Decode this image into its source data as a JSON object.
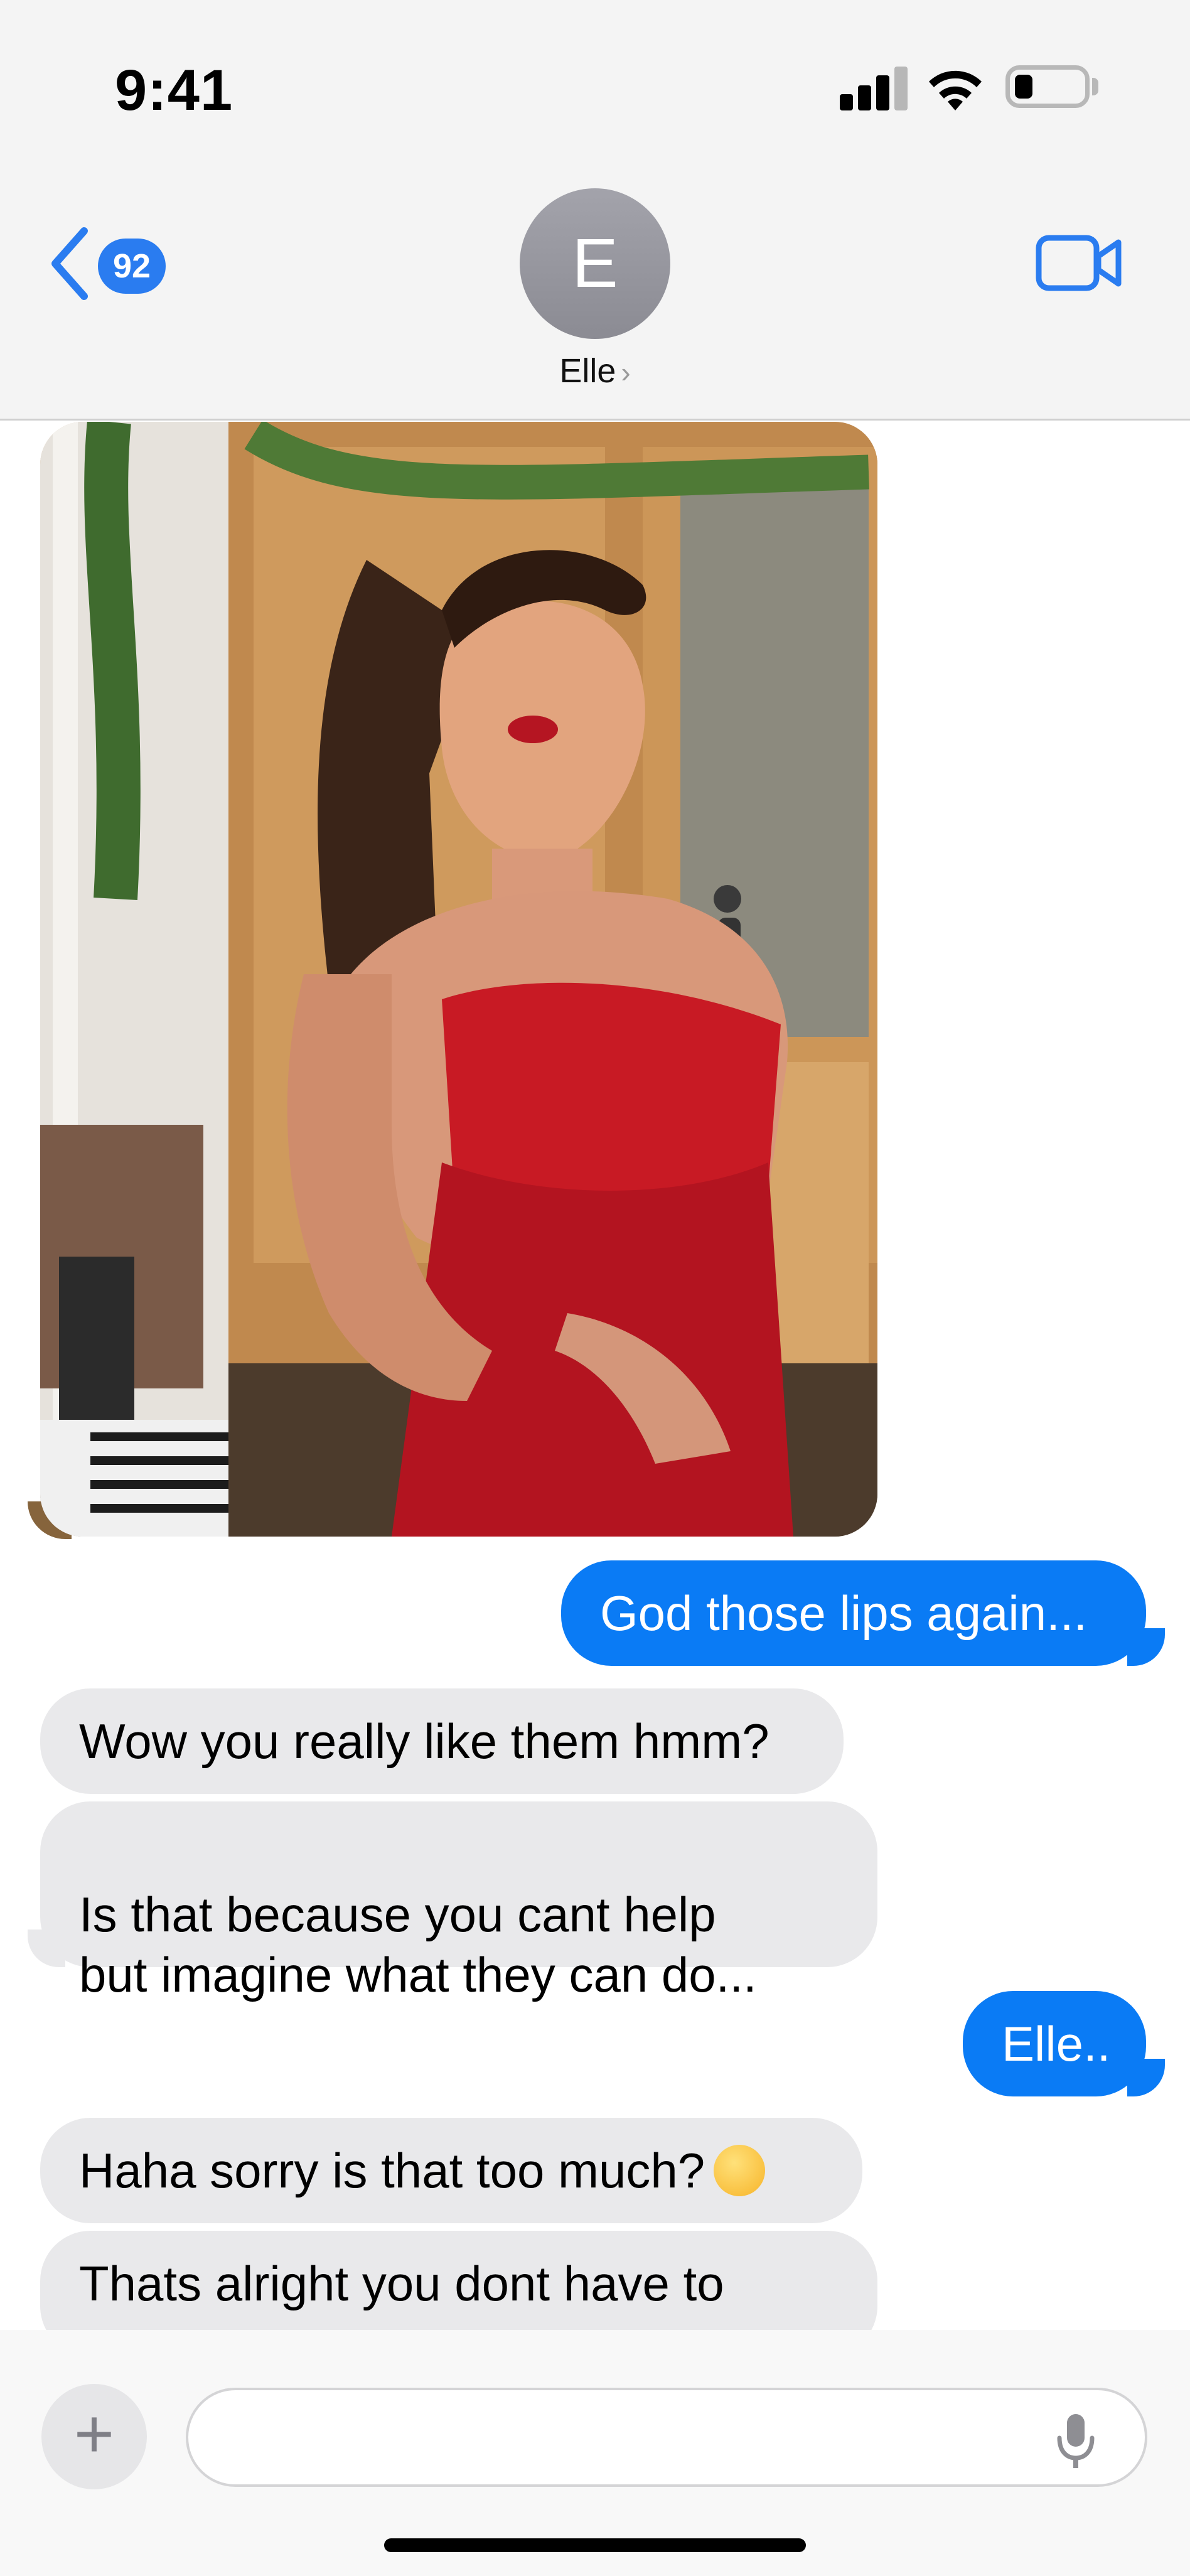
{
  "status_bar": {
    "time": "9:41"
  },
  "header": {
    "unread_count": "92",
    "avatar_initial": "E",
    "contact_name": "Elle",
    "contact_chevron": "›"
  },
  "messages": [
    {
      "direction": "incoming",
      "type": "photo"
    },
    {
      "direction": "outgoing",
      "text": "God those lips again..."
    },
    {
      "direction": "incoming",
      "text": "Wow you really like them hmm?"
    },
    {
      "direction": "incoming",
      "text": "Is that because you cant help\nbut imagine what they can do..."
    },
    {
      "direction": "outgoing",
      "text": "Elle.."
    },
    {
      "direction": "incoming",
      "text": "Haha sorry is that too much?",
      "emoji": "face-with-hand-over-mouth-emoji"
    },
    {
      "direction": "incoming",
      "text": "Thats alright you dont have to"
    }
  ],
  "composer": {
    "plus_label": "+",
    "input_value": ""
  },
  "colors": {
    "outgoing_bubble": "#0a7bf5",
    "incoming_bubble": "#e9e9eb",
    "accent": "#2a7cf0"
  },
  "icons": [
    "back-chevron-icon",
    "video-call-icon",
    "signal-icon",
    "wifi-icon",
    "battery-icon",
    "microphone-icon"
  ]
}
